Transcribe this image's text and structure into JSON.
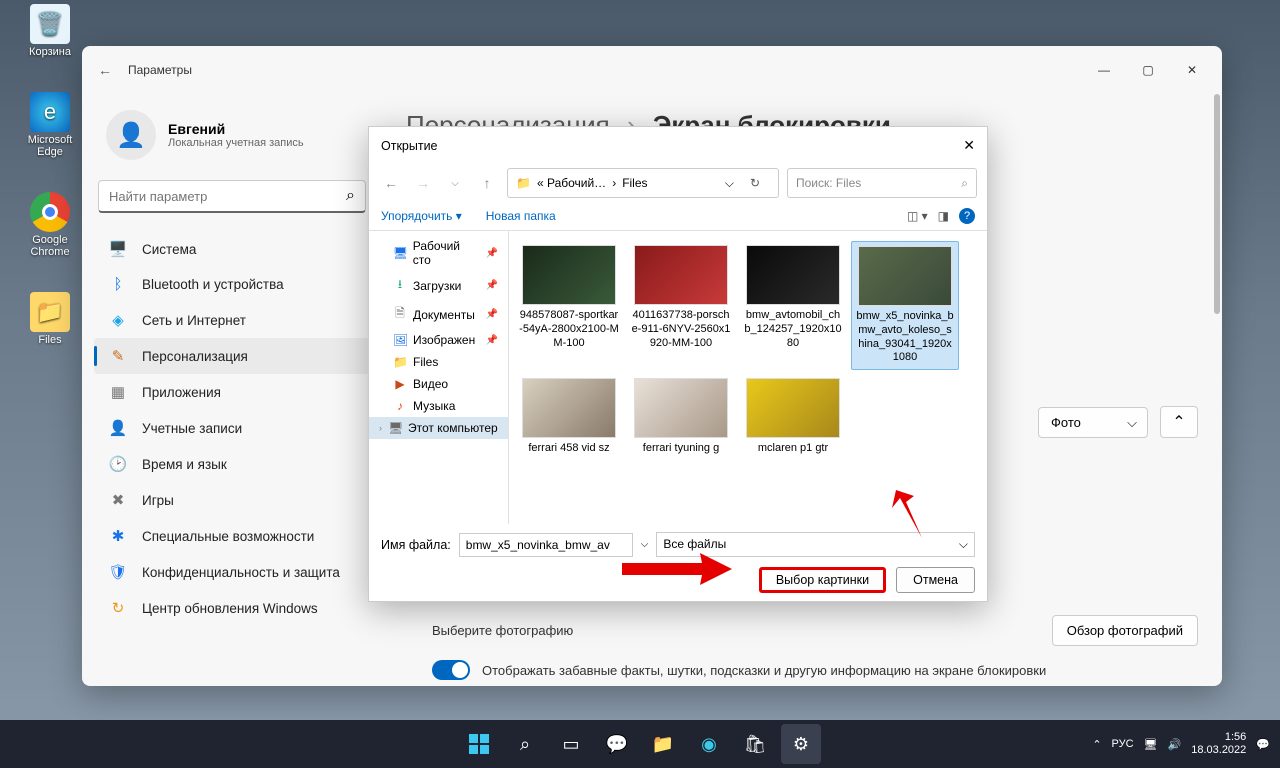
{
  "desktop": {
    "icons": [
      {
        "label": "Корзина",
        "symbol": "🗑️"
      },
      {
        "label": "Microsoft Edge",
        "symbol": "e"
      },
      {
        "label": "Google Chrome",
        "symbol": "◉"
      },
      {
        "label": "Files",
        "symbol": "📁"
      }
    ]
  },
  "settings": {
    "title": "Параметры",
    "user": {
      "name": "Евгений",
      "sub": "Локальная учетная запись"
    },
    "search_placeholder": "Найти параметр",
    "nav": [
      {
        "label": "Система",
        "icon": "🖥️",
        "color": "#1a73e8"
      },
      {
        "label": "Bluetooth и устройства",
        "icon": "ᛒ",
        "color": "#1a73e8"
      },
      {
        "label": "Сеть и Интернет",
        "icon": "◈",
        "color": "#1aa3e8"
      },
      {
        "label": "Персонализация",
        "icon": "✎",
        "color": "#c86f1a",
        "active": true
      },
      {
        "label": "Приложения",
        "icon": "▦",
        "color": "#777"
      },
      {
        "label": "Учетные записи",
        "icon": "👤",
        "color": "#2aa86f"
      },
      {
        "label": "Время и язык",
        "icon": "🕑",
        "color": "#777"
      },
      {
        "label": "Игры",
        "icon": "✖",
        "color": "#777"
      },
      {
        "label": "Специальные возможности",
        "icon": "✱",
        "color": "#1a73e8"
      },
      {
        "label": "Конфиденциальность и защита",
        "icon": "🛡",
        "color": "#1a73e8"
      },
      {
        "label": "Центр обновления Windows",
        "icon": "↻",
        "color": "#e89a1a"
      }
    ],
    "breadcrumb": {
      "main": "Персонализация",
      "sep": "›",
      "sub": "Экран блокировки"
    },
    "photo_dropdown": "Фото",
    "choose_label": "Выберите фотографию",
    "browse_btn": "Обзор фотографий",
    "show_facts": "Отображать забавные факты, шутки, подсказки и другую информацию на экране блокировки"
  },
  "dialog": {
    "title": "Открытие",
    "path_prefix": "« Рабочий…",
    "path_sep": "›",
    "path_leaf": "Files",
    "search_placeholder": "Поиск: Files",
    "organize": "Упорядочить ▾",
    "new_folder": "Новая папка",
    "tree": [
      {
        "label": "Рабочий сто",
        "icon": "🖥",
        "color": "#1a73e8",
        "pin": true
      },
      {
        "label": "Загрузки",
        "icon": "⭳",
        "color": "#2aa86f",
        "pin": true
      },
      {
        "label": "Документы",
        "icon": "🗎",
        "color": "#6a6a6a",
        "pin": true
      },
      {
        "label": "Изображен",
        "icon": "🖼",
        "color": "#1a73e8",
        "pin": true
      },
      {
        "label": "Files",
        "icon": "📁",
        "color": "#f0b429"
      },
      {
        "label": "Видео",
        "icon": "▶",
        "color": "#c84a1a"
      },
      {
        "label": "Музыка",
        "icon": "♪",
        "color": "#e8491a"
      },
      {
        "label": "Этот компьютер",
        "icon": "🖥",
        "color": "#6a6a6a",
        "sel": true,
        "chev": true
      }
    ],
    "files": [
      {
        "name": "948578087-sportkar-54yA-2800x2100-MM-100",
        "bg": "linear-gradient(135deg,#1a2a1a,#3a5a3a)"
      },
      {
        "name": "4011637738-porsche-911-6NYV-2560x1920-MM-100",
        "bg": "linear-gradient(135deg,#8a1a1a,#c83a3a)"
      },
      {
        "name": "bmw_avtomobil_chb_124257_1920x1080",
        "bg": "linear-gradient(135deg,#0a0a0a,#2a2a2a)"
      },
      {
        "name": "bmw_x5_novinka_bmw_avto_koleso_shina_93041_1920x1080",
        "bg": "linear-gradient(135deg,#5a6a4a,#3a4a3a)",
        "selected": true
      },
      {
        "name": "ferrari 458 vid sz",
        "bg": "linear-gradient(135deg,#d8d0c0,#8a7a6a)"
      },
      {
        "name": "ferrari tyuning g",
        "bg": "linear-gradient(135deg,#e8e0d8,#a89888)"
      },
      {
        "name": "mclaren p1 gtr",
        "bg": "linear-gradient(135deg,#e8c81a,#a8881a)"
      }
    ],
    "filename_label": "Имя файла:",
    "filename_value": "bmw_x5_novinka_bmw_av",
    "filter": "Все файлы",
    "open_btn": "Выбор картинки",
    "cancel_btn": "Отмена"
  },
  "taskbar": {
    "lang": "РУС",
    "time": "1:56",
    "date": "18.03.2022"
  }
}
